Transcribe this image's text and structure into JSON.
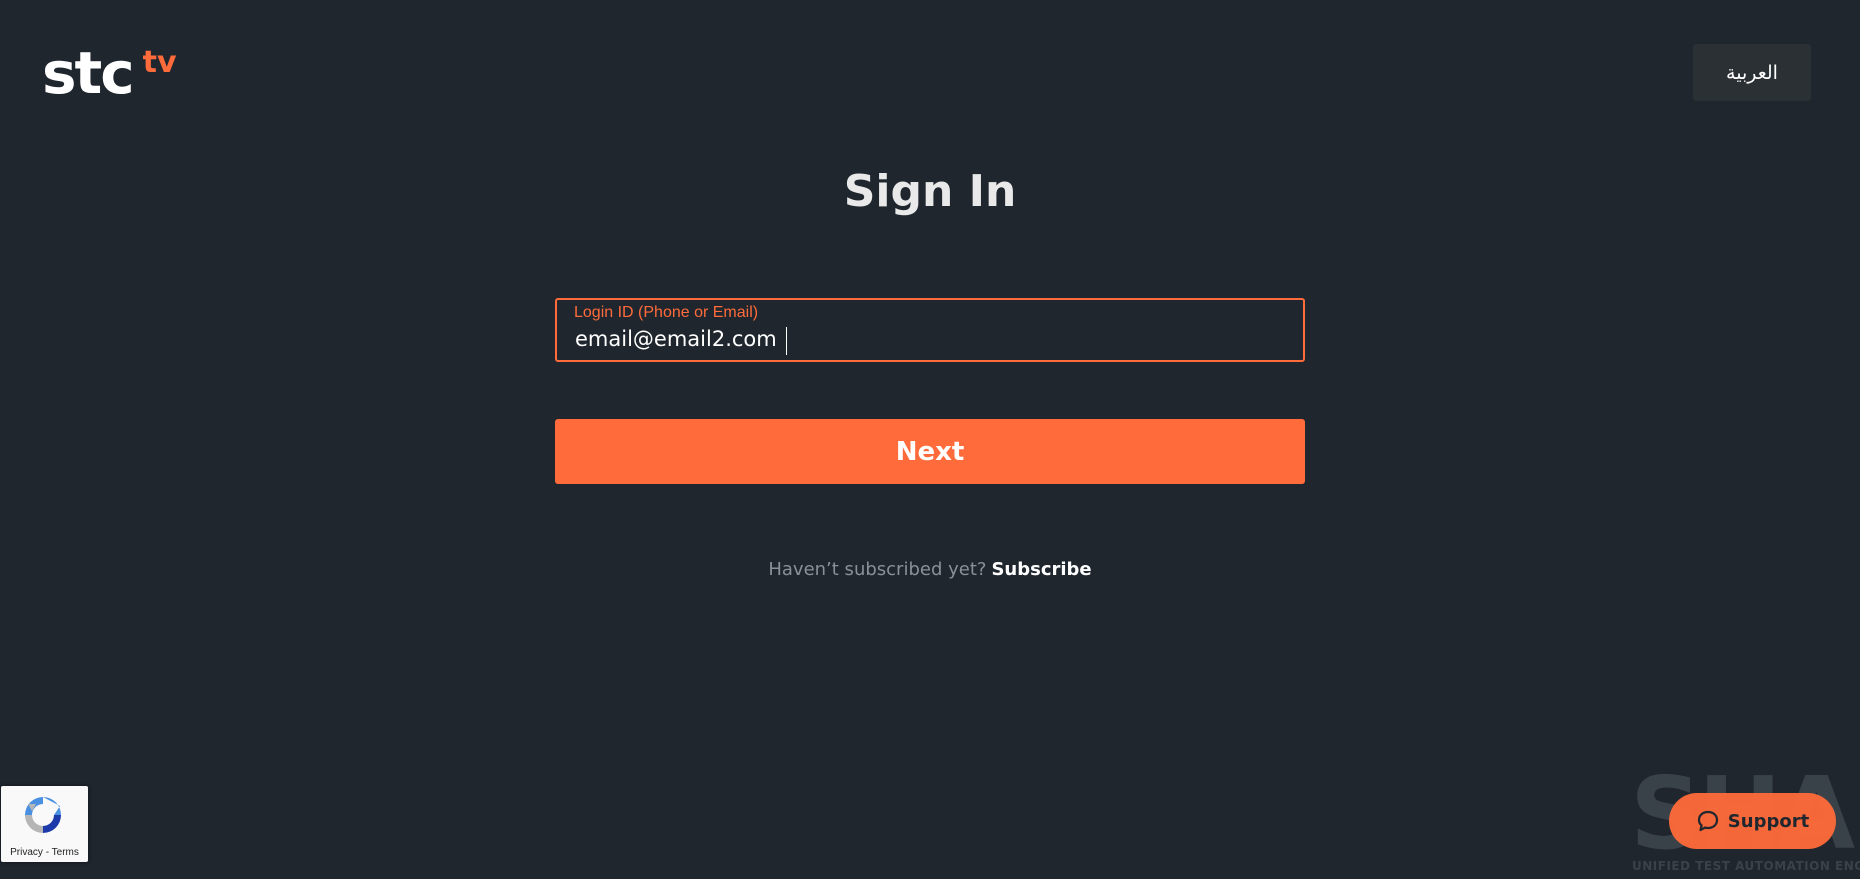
{
  "header": {
    "logo": {
      "main": "stc",
      "accent": "tv"
    },
    "language_label": "العربية"
  },
  "main": {
    "title": "Sign In",
    "login_field": {
      "label": "Login ID (Phone or Email)",
      "value": "email@email2.com"
    },
    "next_label": "Next",
    "subscribe_prompt": "Haven’t subscribed yet?",
    "subscribe_link": "Subscribe"
  },
  "recaptcha": {
    "links": "Privacy - Terms"
  },
  "watermark": {
    "word": "SHAFT",
    "subtitle": "UNIFIED TEST AUTOMATION ENGINE"
  },
  "support": {
    "label": "Support"
  },
  "icons": {
    "recaptcha": "recaptcha-icon",
    "support": "chat-bubble-icon"
  },
  "colors": {
    "background": "#1f262e",
    "accent": "#ff6b3a",
    "lang_button": "#2b3035",
    "muted_text": "#8a9097"
  }
}
